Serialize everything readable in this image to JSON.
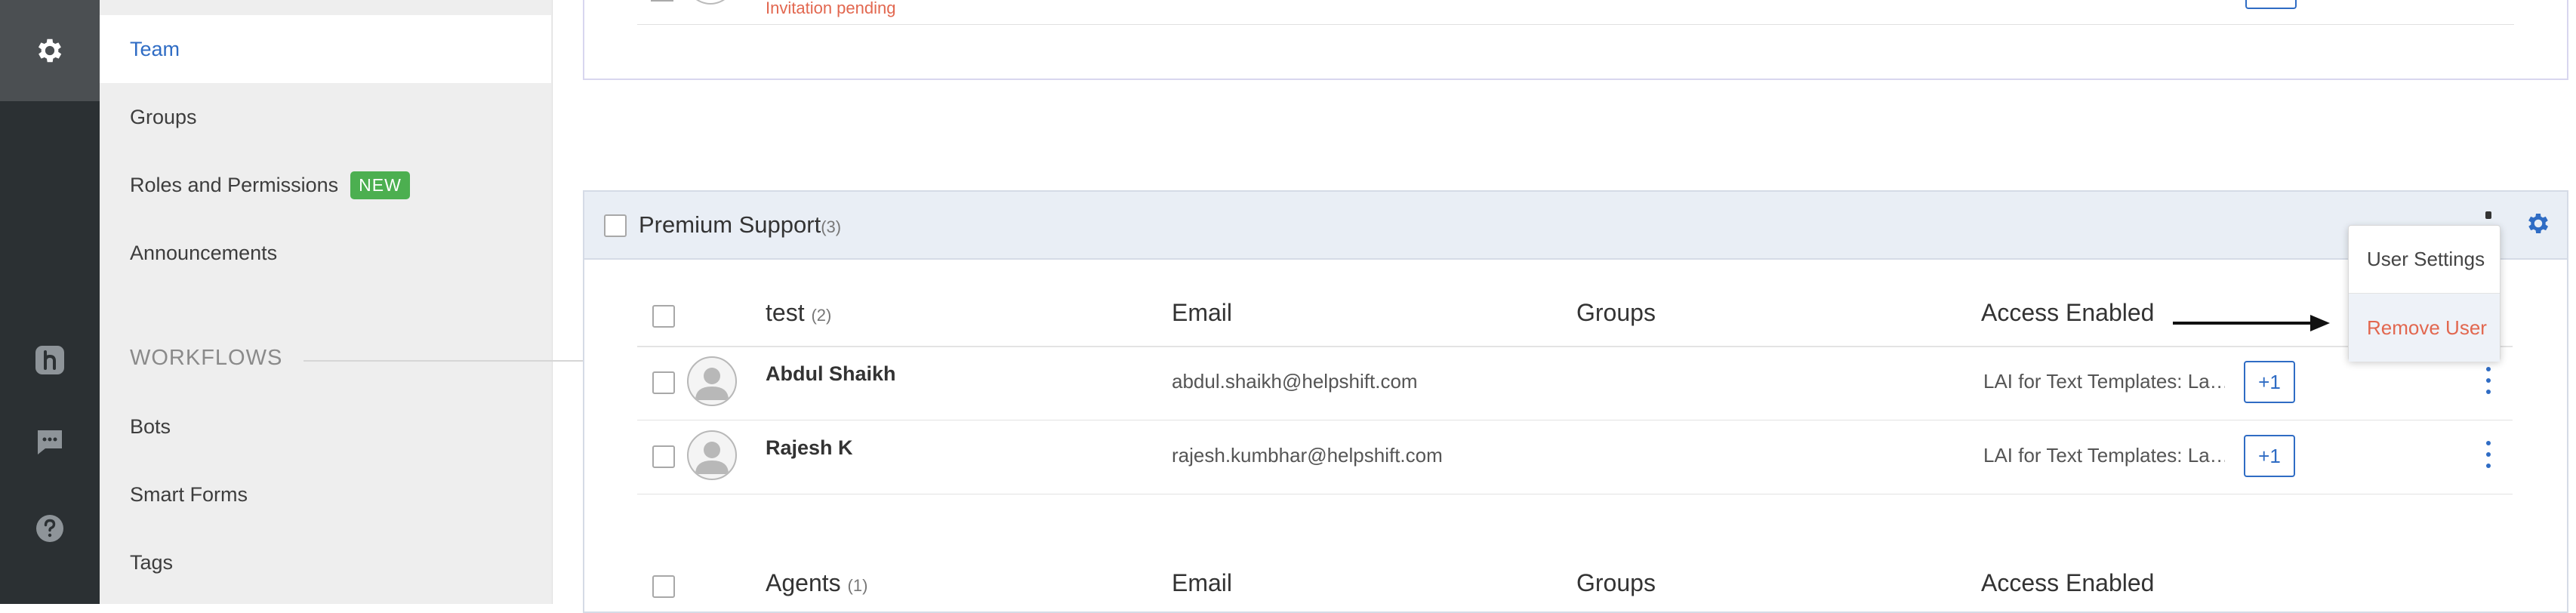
{
  "rail": {
    "items": [
      {
        "icon": "gear-icon",
        "active": true
      },
      {
        "icon": "helpshift-h-icon"
      },
      {
        "icon": "chat-bubble-icon"
      },
      {
        "icon": "help-circle-icon"
      }
    ]
  },
  "sidebar": {
    "items": [
      {
        "label": "Team",
        "active": true
      },
      {
        "label": "Groups"
      },
      {
        "label": "Roles and Permissions",
        "badge": "NEW"
      },
      {
        "label": "Announcements"
      }
    ],
    "section_heading": "WORKFLOWS",
    "workflow_items": [
      {
        "label": "Bots"
      },
      {
        "label": "Smart Forms"
      },
      {
        "label": "Tags"
      }
    ]
  },
  "top_card": {
    "status_text": "Invitation pending"
  },
  "group": {
    "name": "Premium Support",
    "count": "(3)",
    "subgroups": [
      {
        "name": "test",
        "count": "(2)",
        "columns": {
          "email": "Email",
          "groups": "Groups",
          "access": "Access Enabled"
        },
        "users": [
          {
            "name": "Abdul Shaikh",
            "email": "abdul.shaikh@helpshift.com",
            "access": "LAI for Text Templates: La…",
            "more": "+1"
          },
          {
            "name": "Rajesh K",
            "email": "rajesh.kumbhar@helpshift.com",
            "access": "LAI for Text Templates: La…",
            "more": "+1"
          }
        ]
      },
      {
        "name": "Agents",
        "count": "(1)",
        "columns": {
          "email": "Email",
          "groups": "Groups",
          "access": "Access Enabled"
        }
      }
    ]
  },
  "context_menu": {
    "items": [
      "User Settings",
      "Remove User"
    ]
  },
  "colors": {
    "accent": "#2f6cc4",
    "danger": "#e2674f",
    "badge_green": "#4caf50",
    "rail_bg": "#2b3033"
  }
}
